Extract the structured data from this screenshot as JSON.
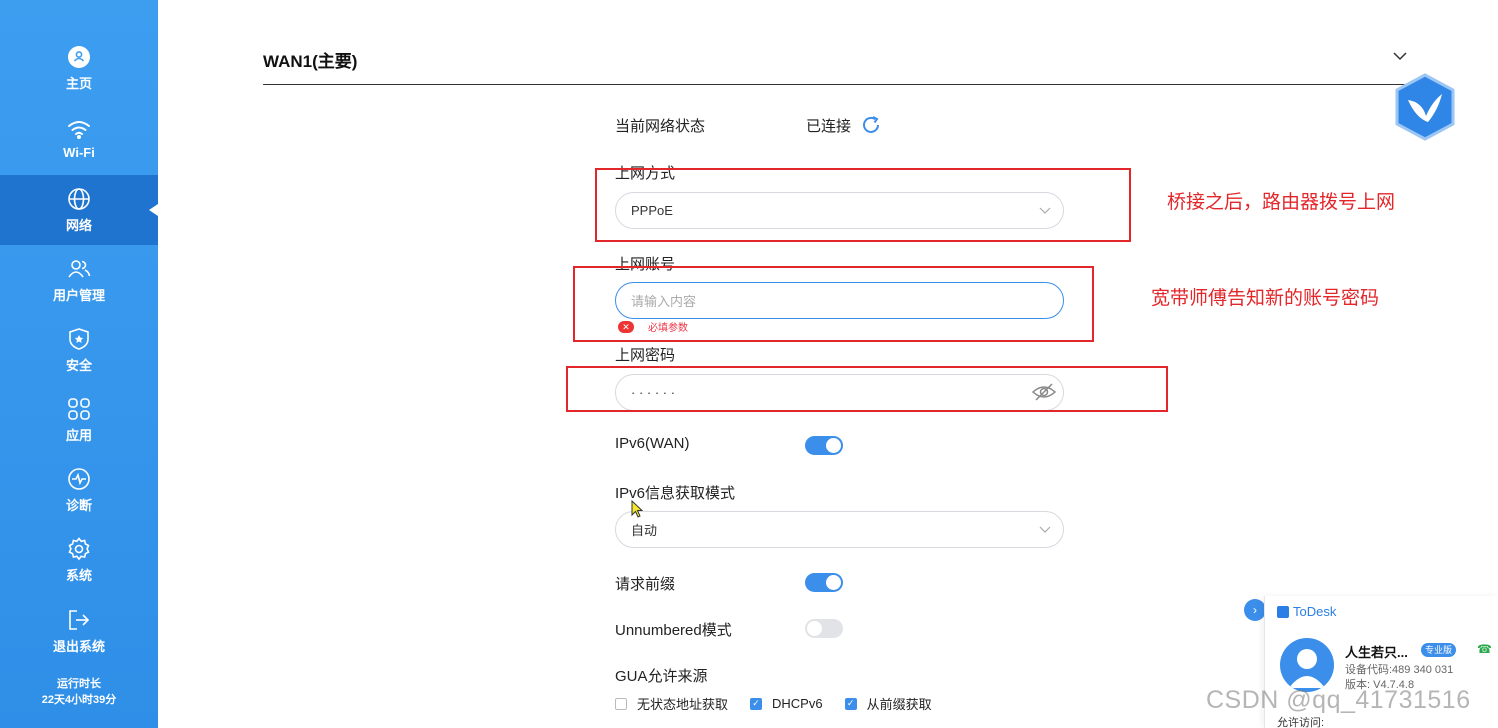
{
  "sidebar": {
    "items": [
      {
        "label": "主页",
        "icon": "home-icon"
      },
      {
        "label": "Wi-Fi",
        "icon": "wifi-icon"
      },
      {
        "label": "网络",
        "icon": "globe-icon",
        "active": true
      },
      {
        "label": "用户管理",
        "icon": "users-icon"
      },
      {
        "label": "安全",
        "icon": "shield-icon"
      },
      {
        "label": "应用",
        "icon": "apps-icon"
      },
      {
        "label": "诊断",
        "icon": "diagnose-icon"
      },
      {
        "label": "系统",
        "icon": "gear-icon"
      },
      {
        "label": "退出系统",
        "icon": "logout-icon"
      }
    ],
    "uptime_label": "运行时长",
    "uptime_value": "22天4小时39分"
  },
  "section": {
    "title": "WAN1(主要)"
  },
  "form": {
    "status_label": "当前网络状态",
    "status_value": "已连接",
    "mode_label": "上网方式",
    "mode_value": "PPPoE",
    "account_label": "上网账号",
    "account_placeholder": "请输入内容",
    "account_error": "必填参数",
    "password_label": "上网密码",
    "password_value": "· · · · · ·",
    "ipv6_label": "IPv6(WAN)",
    "ipv6_enabled": true,
    "ipv6_mode_label": "IPv6信息获取模式",
    "ipv6_mode_value": "自动",
    "prefix_label": "请求前缀",
    "prefix_enabled": true,
    "unnumbered_label": "Unnumbered模式",
    "unnumbered_enabled": false,
    "gua_label": "GUA允许来源",
    "gua_options": [
      {
        "label": "无状态地址获取",
        "checked": false
      },
      {
        "label": "DHCPv6",
        "checked": true
      },
      {
        "label": "从前缀获取",
        "checked": true
      }
    ]
  },
  "annotations": {
    "mode_note": "桥接之后，路由器拨号上网",
    "account_note": "宽带师傅告知新的账号密码"
  },
  "todesk": {
    "brand": "ToDesk",
    "name": "人生若只...",
    "badge": "专业版",
    "device_code": "设备代码:489 340 031",
    "version": "版本: V4.7.4.8",
    "allow": "允许访问:"
  },
  "watermark": "CSDN @qq_41731516",
  "colors": {
    "accent": "#3b8eea",
    "annotation": "#e3262a",
    "sidebar": "#3d9ef0"
  }
}
